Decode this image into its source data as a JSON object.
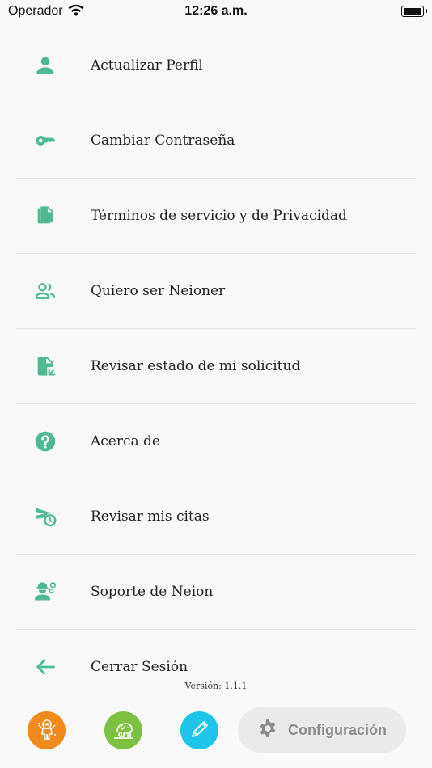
{
  "status_bar": {
    "carrier": "Operador",
    "time": "12:26 a.m."
  },
  "colors": {
    "accent": "#4fba92",
    "orange": "#f08a1d",
    "green": "#7cc141",
    "blue": "#1fc4ea"
  },
  "menu": {
    "items": [
      {
        "label": "Actualizar Perfil",
        "icon": "person-icon"
      },
      {
        "label": "Cambiar Contraseña",
        "icon": "key-icon"
      },
      {
        "label": "Términos de servicio y de Privacidad",
        "icon": "documents-icon"
      },
      {
        "label": "Quiero ser Neioner",
        "icon": "people-icon"
      },
      {
        "label": "Revisar estado de mi solicitud",
        "icon": "file-status-icon"
      },
      {
        "label": "Acerca de",
        "icon": "help-circle-icon"
      },
      {
        "label": "Revisar mis citas",
        "icon": "scheduled-send-icon"
      },
      {
        "label": "Soporte de Neion",
        "icon": "engineer-icon"
      },
      {
        "label": "Cerrar Sesión",
        "icon": "arrow-back-icon"
      }
    ]
  },
  "version": "Versión: 1.1.1",
  "bottom_nav": {
    "config_label": "Configuración"
  }
}
